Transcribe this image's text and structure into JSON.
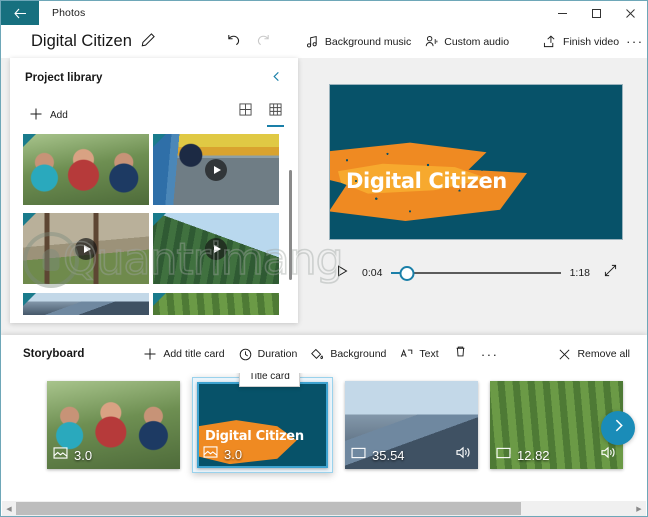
{
  "titlebar": {
    "back_icon": "arrow-left-icon",
    "app_name": "Photos",
    "minimize_label": "─",
    "maximize_label": "□",
    "close_label": "✕"
  },
  "commandbar": {
    "project_title": "Digital Citizen",
    "edit_icon": "pencil-icon",
    "undo_icon": "undo-icon",
    "redo_icon": "redo-icon",
    "background_music": "Background music",
    "custom_audio": "Custom audio",
    "finish_video": "Finish video",
    "more_label": "···"
  },
  "library": {
    "title": "Project library",
    "collapse_icon": "chevron-left-icon",
    "add_label": "Add",
    "view_large_icon": "grid-large-icon",
    "view_small_icon": "grid-small-icon",
    "items": [
      {
        "name": "clip-cyclists",
        "kind": "photo"
      },
      {
        "name": "clip-playground",
        "kind": "video"
      },
      {
        "name": "clip-park",
        "kind": "video"
      },
      {
        "name": "clip-forest",
        "kind": "video"
      },
      {
        "name": "clip-mountain",
        "kind": "photo"
      },
      {
        "name": "clip-trees",
        "kind": "photo"
      }
    ]
  },
  "watermark": {
    "text": "Quantrimang"
  },
  "preview": {
    "card_title": "Digital Citizen",
    "play_icon": "play-icon",
    "current_time": "0:04",
    "total_time": "1:18",
    "expand_icon": "expand-icon",
    "progress_percent": 9
  },
  "storyboard": {
    "title": "Storyboard",
    "add_title_card": "Add title card",
    "duration": "Duration",
    "background": "Background",
    "text": "Text",
    "delete_icon": "trash-icon",
    "more_label": "···",
    "remove_all": "Remove all",
    "tooltip": "Title card",
    "next_icon": "chevron-right-icon",
    "clips": [
      {
        "name": "clip-cyclists",
        "duration": "3.0",
        "type_icon": "photo-icon",
        "has_audio": false,
        "selected": false
      },
      {
        "name": "clip-title-card",
        "duration": "3.0",
        "type_icon": "photo-icon",
        "has_audio": false,
        "selected": true,
        "card_title": "Digital Citizen"
      },
      {
        "name": "clip-mountains",
        "duration": "35.54",
        "type_icon": "video-icon",
        "has_audio": true,
        "selected": false
      },
      {
        "name": "clip-trees",
        "duration": "12.82",
        "type_icon": "video-icon",
        "has_audio": true,
        "selected": false
      }
    ]
  },
  "scrollbar": {
    "left_arrow": "◀",
    "right_arrow": "▶"
  },
  "colors": {
    "accent": "#1a7fa8",
    "teal": "#17707f",
    "card_bg": "#075269",
    "orange": "#ef8a22"
  }
}
